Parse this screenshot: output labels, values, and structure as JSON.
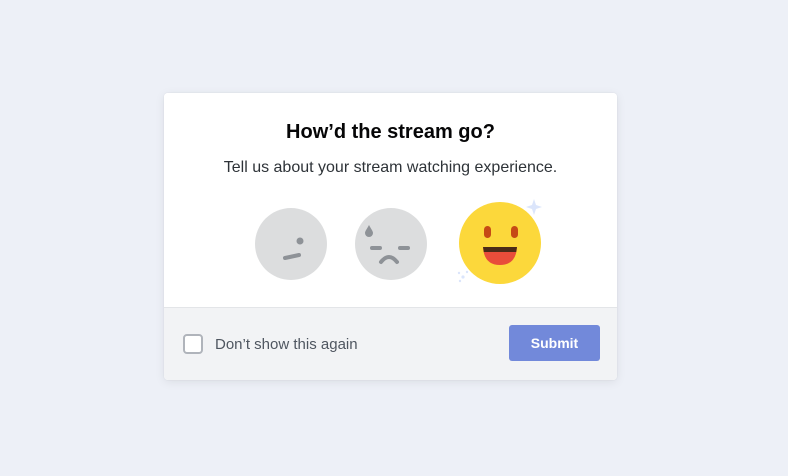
{
  "dialog": {
    "title": "How’d the stream go?",
    "subtitle": "Tell us about your stream watching experience.",
    "ratings": [
      {
        "name": "neutral",
        "icon": "neutral-face-icon",
        "selected": false
      },
      {
        "name": "sad",
        "icon": "sad-sweat-face-icon",
        "selected": false
      },
      {
        "name": "happy",
        "icon": "happy-face-icon",
        "selected": true
      }
    ],
    "dont_show_again": {
      "label": "Don’t show this again",
      "checked": false
    },
    "submit_label": "Submit"
  },
  "colors": {
    "background": "#edf0f7",
    "accent": "#7289da",
    "face_inactive": "#dcddde",
    "face_happy": "#fcd83b"
  }
}
